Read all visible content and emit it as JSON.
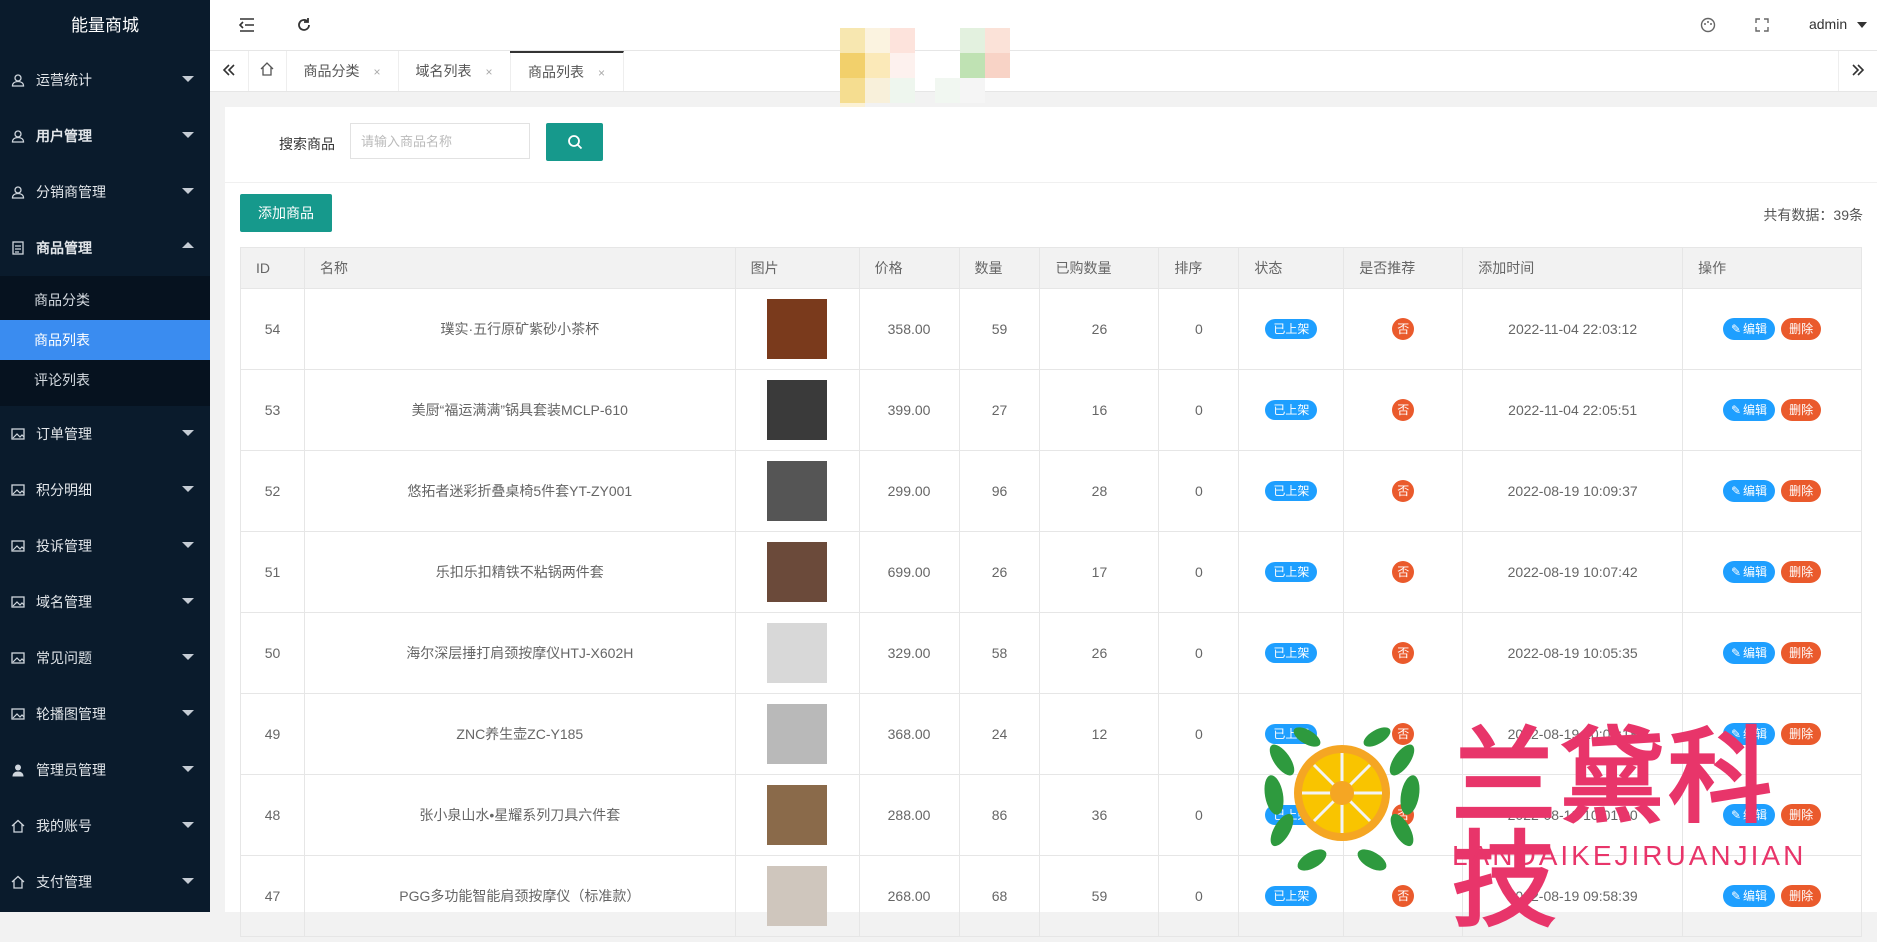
{
  "app": {
    "title": "能量商城"
  },
  "sidebar": {
    "items": [
      {
        "label": "运营统计",
        "icon": "user-icon",
        "expanded": false
      },
      {
        "label": "用户管理",
        "icon": "user-icon",
        "expanded": false
      },
      {
        "label": "分销商管理",
        "icon": "user-icon",
        "expanded": false
      },
      {
        "label": "商品管理",
        "icon": "doc-icon",
        "expanded": true,
        "children": [
          {
            "label": "商品分类"
          },
          {
            "label": "商品列表",
            "active": true
          },
          {
            "label": "评论列表"
          }
        ]
      },
      {
        "label": "订单管理",
        "icon": "image-icon",
        "expanded": false
      },
      {
        "label": "积分明细",
        "icon": "image-icon",
        "expanded": false
      },
      {
        "label": "投诉管理",
        "icon": "image-icon",
        "expanded": false
      },
      {
        "label": "域名管理",
        "icon": "image-icon",
        "expanded": false
      },
      {
        "label": "常见问题",
        "icon": "image-icon",
        "expanded": false
      },
      {
        "label": "轮播图管理",
        "icon": "image-icon",
        "expanded": false
      },
      {
        "label": "管理员管理",
        "icon": "person-icon",
        "expanded": false
      },
      {
        "label": "我的账号",
        "icon": "home-icon",
        "expanded": false
      },
      {
        "label": "支付管理",
        "icon": "home-icon",
        "expanded": false
      }
    ]
  },
  "topbar": {
    "user": "admin"
  },
  "tabs": [
    {
      "label": "商品分类",
      "active": false
    },
    {
      "label": "域名列表",
      "active": false
    },
    {
      "label": "商品列表",
      "active": true
    }
  ],
  "search": {
    "label": "搜索商品",
    "placeholder": "请输入商品名称"
  },
  "toolbar": {
    "add_label": "添加商品",
    "total_text": "共有数据：39条"
  },
  "table": {
    "headers": [
      "ID",
      "名称",
      "图片",
      "价格",
      "数量",
      "已购数量",
      "排序",
      "状态",
      "是否推荐",
      "添加时间",
      "操作"
    ],
    "status_label": "已上架",
    "recommend_label": "否",
    "edit_label": "编辑",
    "delete_label": "删除",
    "rows": [
      {
        "id": "54",
        "name": "璞实·五行原矿紫砂小茶杯",
        "price": "358.00",
        "qty": "59",
        "sold": "26",
        "sort": "0",
        "time": "2022-11-04 22:03:12",
        "thumb": "#7a3a1c"
      },
      {
        "id": "53",
        "name": "美厨“福运满满”锅具套装MCLP-610",
        "price": "399.00",
        "qty": "27",
        "sold": "16",
        "sort": "0",
        "time": "2022-11-04 22:05:51",
        "thumb": "#3a3a3a"
      },
      {
        "id": "52",
        "name": "悠拓者迷彩折叠桌椅5件套YT-ZY001",
        "price": "299.00",
        "qty": "96",
        "sold": "28",
        "sort": "0",
        "time": "2022-08-19 10:09:37",
        "thumb": "#555555"
      },
      {
        "id": "51",
        "name": "乐扣乐扣精铁不粘锅两件套",
        "price": "699.00",
        "qty": "26",
        "sold": "17",
        "sort": "0",
        "time": "2022-08-19 10:07:42",
        "thumb": "#6b4a3a"
      },
      {
        "id": "50",
        "name": "海尔深层捶打肩颈按摩仪HTJ-X602H",
        "price": "329.00",
        "qty": "58",
        "sold": "26",
        "sort": "0",
        "time": "2022-08-19 10:05:35",
        "thumb": "#d8d8d8"
      },
      {
        "id": "49",
        "name": "ZNC养生壶ZC-Y185",
        "price": "368.00",
        "qty": "24",
        "sold": "12",
        "sort": "0",
        "time": "2022-08-19 10:03:18",
        "thumb": "#b9b9b9"
      },
      {
        "id": "48",
        "name": "张小泉山水•星耀系列刀具六件套",
        "price": "288.00",
        "qty": "86",
        "sold": "36",
        "sort": "0",
        "time": "2022-08-19 10:01:00",
        "thumb": "#8a6a4a"
      },
      {
        "id": "47",
        "name": "PGG多功能智能肩颈按摩仪（标准款）",
        "price": "268.00",
        "qty": "68",
        "sold": "59",
        "sort": "0",
        "time": "2022-08-19 09:58:39",
        "thumb": "#cfc6bd"
      }
    ]
  },
  "watermark": {
    "title": "兰黛科技",
    "subtitle": "LANDAIKEJIRUANJIAN"
  }
}
